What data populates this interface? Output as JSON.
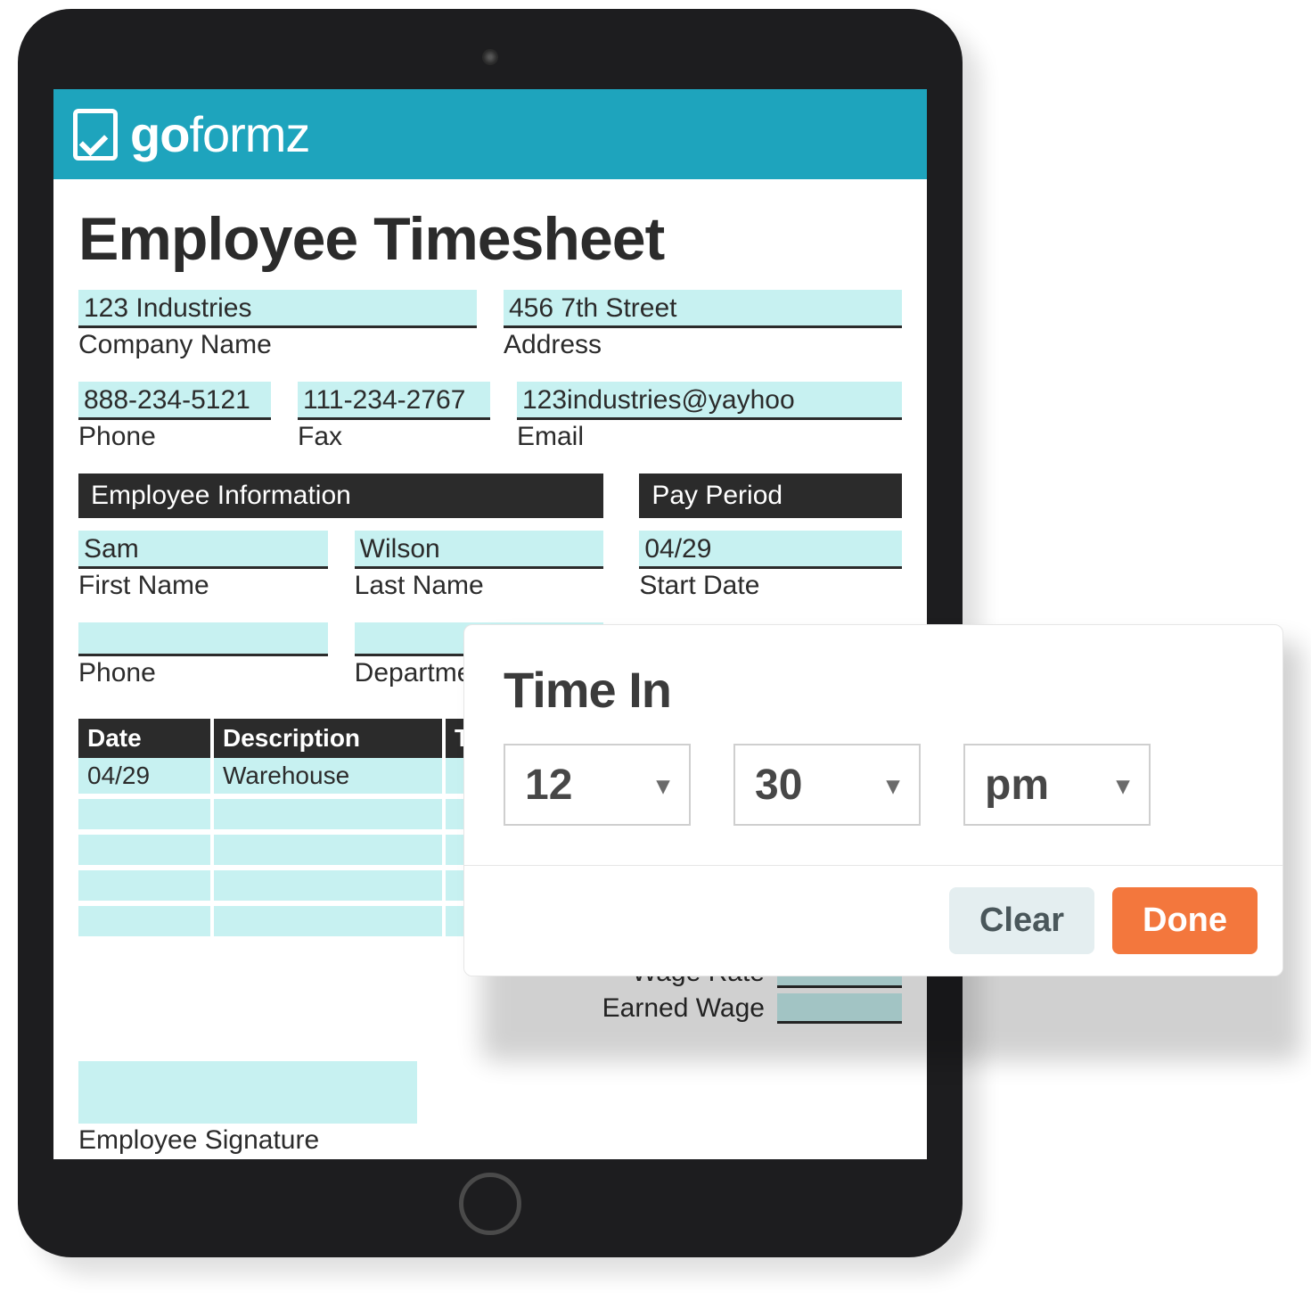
{
  "brand": {
    "name_bold": "go",
    "name_light": "formz",
    "logo_name": "goformz-logo"
  },
  "form": {
    "title": "Employee Timesheet",
    "company": {
      "value": "123 Industries",
      "label": "Company Name"
    },
    "address": {
      "value": "456 7th Street",
      "label": "Address"
    },
    "phone": {
      "value": "888-234-5121",
      "label": "Phone"
    },
    "fax": {
      "value": "111-234-2767",
      "label": "Fax"
    },
    "email": {
      "value": "123industries@yayhoo",
      "label": "Email"
    },
    "sections": {
      "employee_info": "Employee Information",
      "pay_period": "Pay Period"
    },
    "employee": {
      "first_name": {
        "value": "Sam",
        "label": "First Name"
      },
      "last_name": {
        "value": "Wilson",
        "label": "Last Name"
      },
      "emp_phone": {
        "value": "",
        "label": "Phone"
      },
      "department": {
        "value": "",
        "label": "Department"
      }
    },
    "pay_period": {
      "start_date": {
        "value": "04/29",
        "label": "Start Date"
      }
    },
    "table": {
      "headers": [
        "Date",
        "Description",
        "T"
      ],
      "rows": [
        {
          "date": "04/29",
          "description": "Warehouse",
          "t": ""
        },
        {
          "date": "",
          "description": "",
          "t": ""
        },
        {
          "date": "",
          "description": "",
          "t": ""
        },
        {
          "date": "",
          "description": "",
          "t": ""
        },
        {
          "date": "",
          "description": "",
          "t": ""
        }
      ]
    },
    "totals": {
      "wage_rate": "Wage Rate",
      "earned_wage": "Earned Wage"
    },
    "signature_label": "Employee Signature"
  },
  "popover": {
    "title": "Time In",
    "hour": "12",
    "minute": "30",
    "meridiem": "pm",
    "clear": "Clear",
    "done": "Done"
  }
}
